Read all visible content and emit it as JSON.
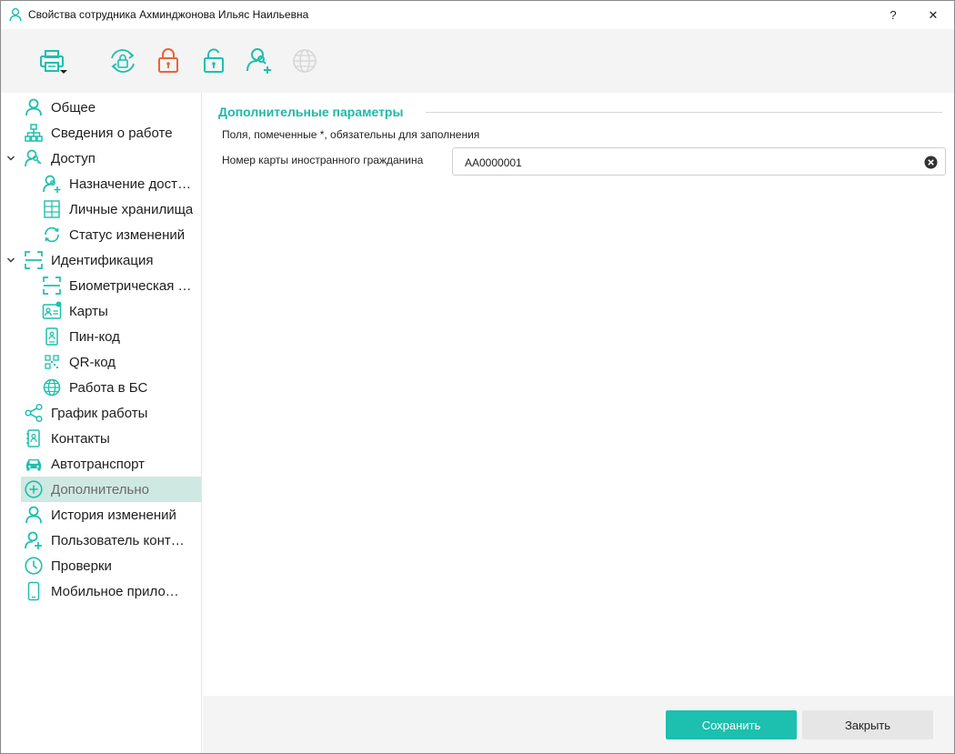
{
  "window": {
    "title": "Свойства сотрудника Ахминджонова Ильяс Наильевна",
    "help_label": "?",
    "close_label": "✕"
  },
  "toolbar": {
    "items": [
      {
        "icon": "printer-icon"
      },
      {
        "icon": "rotate-lock-icon"
      },
      {
        "icon": "lock-closed-icon"
      },
      {
        "icon": "lock-open-icon"
      },
      {
        "icon": "user-add-icon"
      },
      {
        "icon": "globe-icon"
      }
    ],
    "accent_color": "#1dbfae",
    "alert_color": "#e8643c",
    "disabled_color": "#d5d5d5"
  },
  "sidebar": {
    "items": [
      {
        "label": "Общее",
        "icon": "user-icon"
      },
      {
        "label": "Сведения о работе",
        "icon": "org-chart-icon"
      },
      {
        "label": "Доступ",
        "icon": "user-key-icon"
      },
      {
        "label": "Назначение доступа",
        "icon": "user-add-icon"
      },
      {
        "label": "Личные хранилища",
        "icon": "storage-grid-icon"
      },
      {
        "label": "Статус изменений",
        "icon": "refresh-icon"
      },
      {
        "label": "Идентификация",
        "icon": "scan-frame-icon"
      },
      {
        "label": "Биометрическая идентификация",
        "icon": "scan-frame-icon"
      },
      {
        "label": "Карты",
        "icon": "id-card-icon"
      },
      {
        "label": "Пин-код",
        "icon": "keypad-icon"
      },
      {
        "label": "QR-код",
        "icon": "qr-code-icon"
      },
      {
        "label": "Работа в БС",
        "icon": "globe-icon"
      },
      {
        "label": "График работы",
        "icon": "share-icon"
      },
      {
        "label": "Контакты",
        "icon": "address-book-icon"
      },
      {
        "label": "Автотранспорт",
        "icon": "car-icon"
      },
      {
        "label": "Дополнительно",
        "icon": "plus-circle-icon"
      },
      {
        "label": "История изменений",
        "icon": "user-icon"
      },
      {
        "label": "Пользователь контроллера",
        "icon": "user-add-icon"
      },
      {
        "label": "Проверки",
        "icon": "clock-icon"
      },
      {
        "label": "Мобильное приложение",
        "icon": "phone-icon"
      }
    ]
  },
  "main": {
    "section_title": "Дополнительные параметры",
    "required_note": "Поля, помеченные *, обязательны для заполнения",
    "field_label": "Номер карты иностранного гражданина",
    "field_value": "AA0000001"
  },
  "footer": {
    "save_label": "Сохранить",
    "close_label": "Закрыть"
  }
}
